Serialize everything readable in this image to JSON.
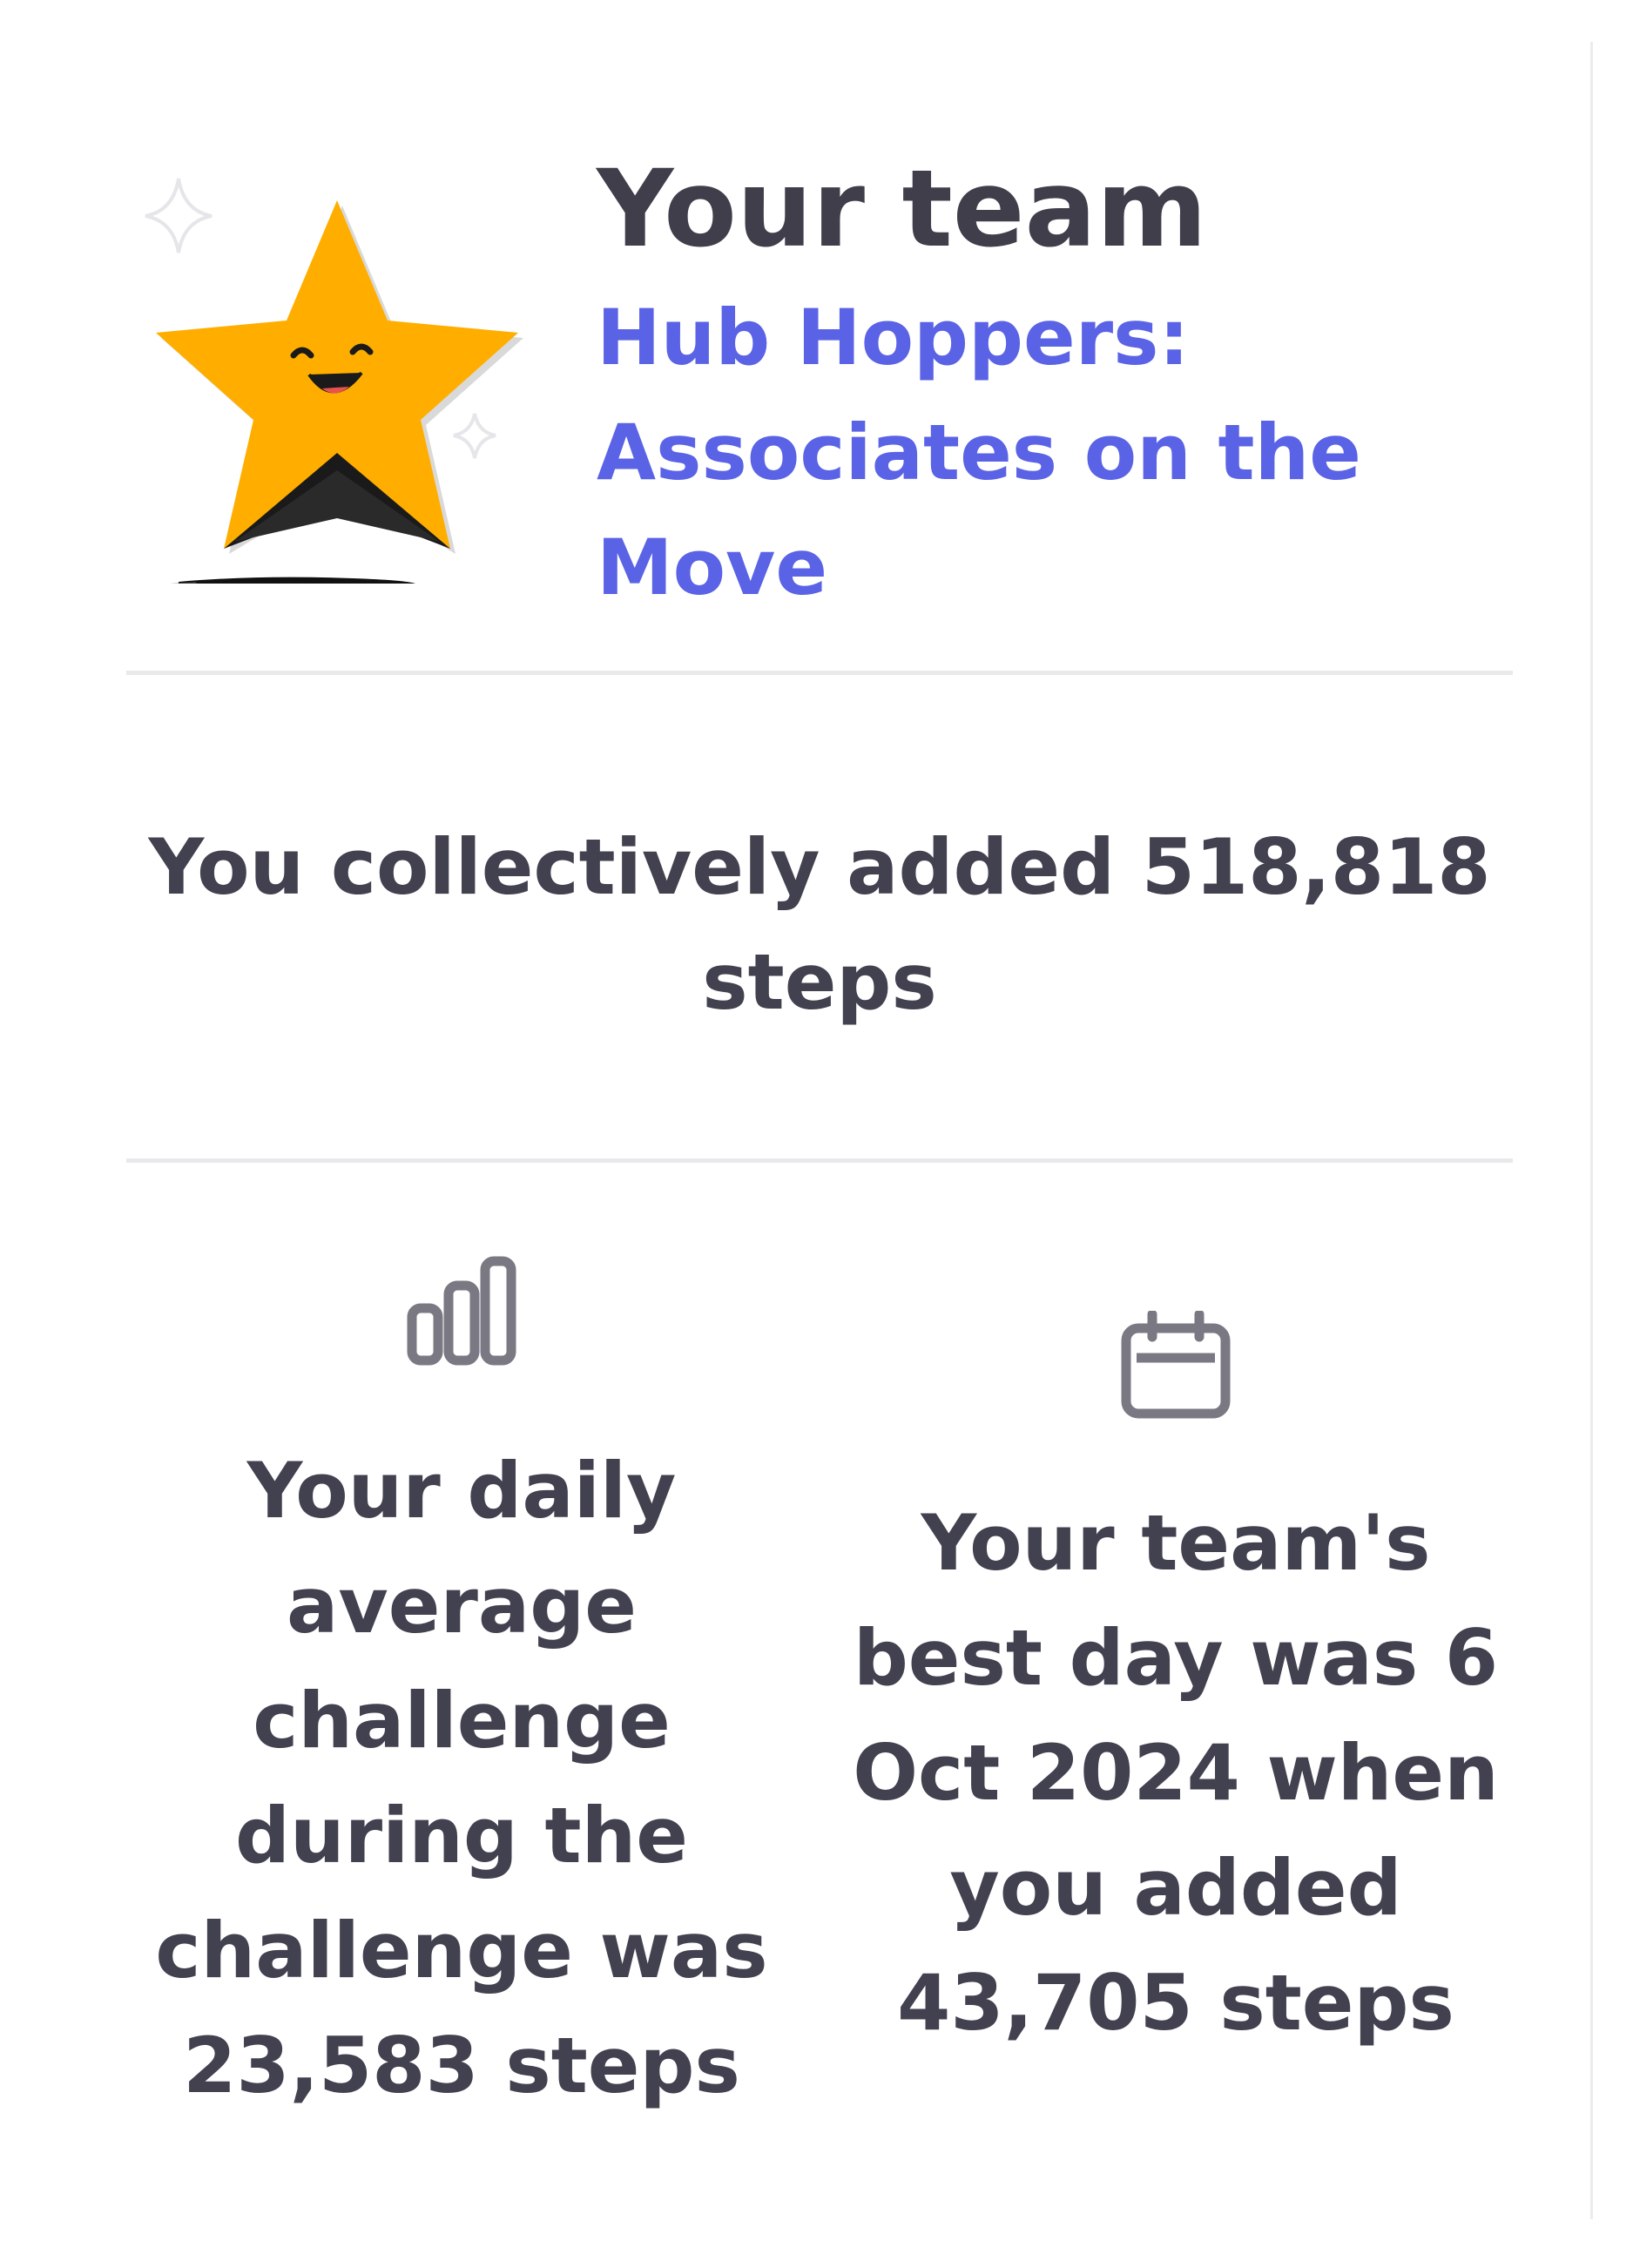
{
  "team": {
    "heading": "Your team",
    "name": "Hub Hoppers: Associates on the Move"
  },
  "summary": {
    "text": "You collectively added 518,818 steps"
  },
  "stats": {
    "daily_average": {
      "icon": "bar-chart-icon",
      "text": "Your daily average challenge during the challenge was 23,583 steps"
    },
    "best_day": {
      "icon": "calendar-icon",
      "text": "Your team's best day was 6 Oct 2024 when you added 43,705 steps"
    }
  },
  "colors": {
    "heading": "#3f3e4a",
    "link": "#5a63e6",
    "body": "#42414f",
    "star": "#ffae00",
    "icon": "#7a7983",
    "divider": "#e9e9ec"
  }
}
